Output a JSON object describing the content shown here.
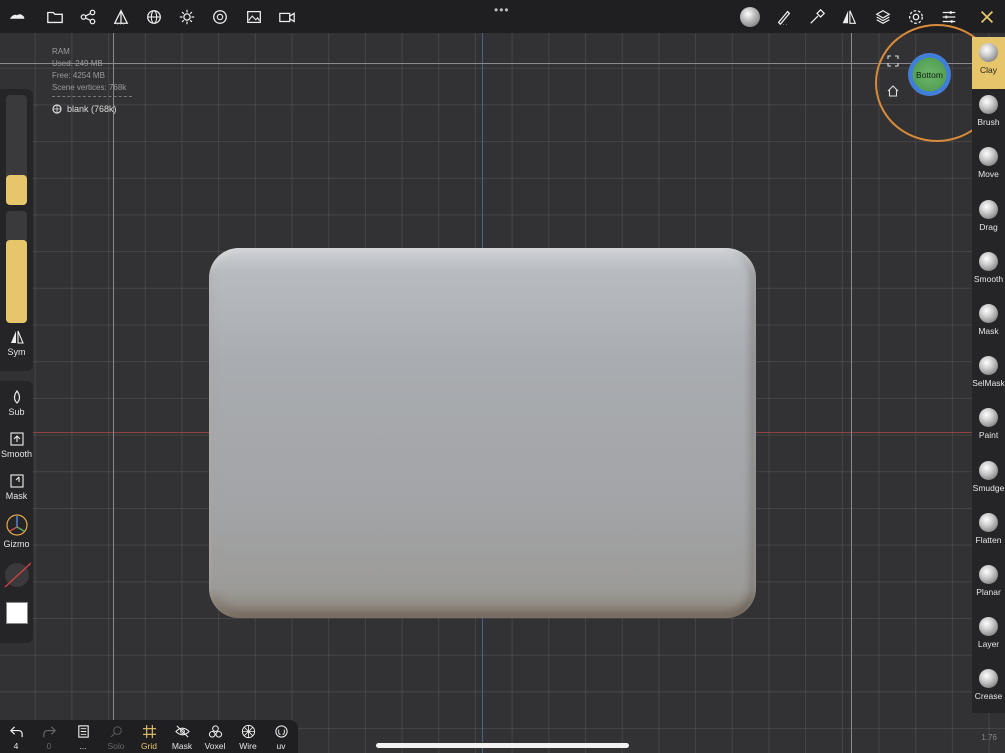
{
  "topbar": {
    "left_icons": [
      "nomad-logo-icon",
      "folder-icon",
      "scene-graph-icon",
      "primitive-icon",
      "globe-icon",
      "light-icon",
      "material-icon",
      "image-icon",
      "camera-video-icon"
    ],
    "right_icons": [
      "matcap-icon",
      "brush-stroke-icon",
      "picker-icon",
      "symmetry-icon",
      "layers-icon",
      "settings-icon",
      "sliders-icon",
      "tools-icon"
    ]
  },
  "info": {
    "ram": "RAM",
    "used": "Used: 249 MB",
    "free": "Free: 4254 MB",
    "vertices": "Scene vertices: 768k",
    "scene_item": "blank (768k)"
  },
  "left": {
    "sym": "Sym",
    "sub": "Sub",
    "smooth": "Smooth",
    "mask": "Mask",
    "gizmo": "Gizmo",
    "slider_top_value": 0.2,
    "slider_bottom_value": 0.75
  },
  "view": {
    "label": "Bottom"
  },
  "brushes": [
    {
      "label": "Clay",
      "active": true
    },
    {
      "label": "Brush"
    },
    {
      "label": "Move"
    },
    {
      "label": "Drag"
    },
    {
      "label": "Smooth"
    },
    {
      "label": "Mask"
    },
    {
      "label": "SelMask"
    },
    {
      "label": "Paint"
    },
    {
      "label": "Smudge"
    },
    {
      "label": "Flatten"
    },
    {
      "label": "Planar"
    },
    {
      "label": "Layer"
    },
    {
      "label": "Crease"
    }
  ],
  "bottom": {
    "undo_count": "4",
    "redo_count": "0",
    "more": "...",
    "solo": "Solo",
    "grid": "Grid",
    "mask": "Mask",
    "voxel": "Voxel",
    "wire": "Wire",
    "uv": "uv"
  },
  "version": "1.76",
  "colors": {
    "accent": "#e7c56a",
    "axis_x": "#b04a4a",
    "axis_y": "#4a6ab0",
    "ring": "#d98b3a"
  }
}
